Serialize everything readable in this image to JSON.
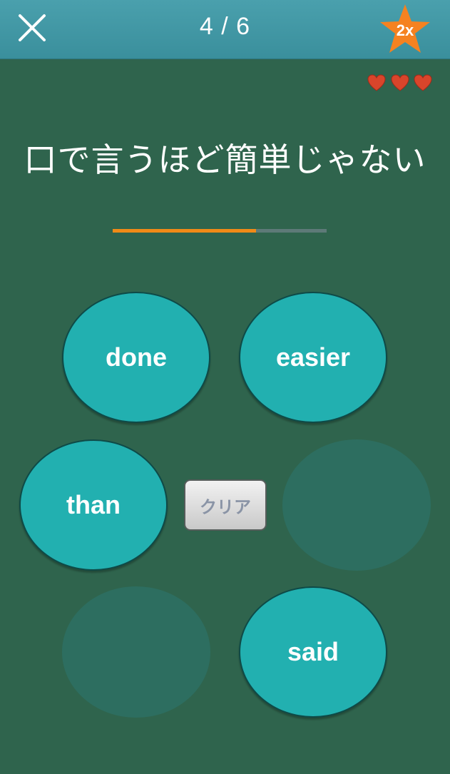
{
  "header": {
    "close_icon": "close-icon",
    "progress_text": "4 / 6",
    "multiplier_label": "2x",
    "multiplier_icon": "star-icon",
    "multiplier_color": "#f58220"
  },
  "lives": {
    "count": 3,
    "icon": "heart-icon",
    "color": "#d9452b"
  },
  "question": {
    "prompt": "口で言うほど簡単じゃない",
    "answer_progress": 0.67
  },
  "word_options": [
    {
      "label": "done"
    },
    {
      "label": "easier"
    },
    {
      "label": "than"
    },
    {
      "label": ""
    },
    {
      "label": ""
    },
    {
      "label": "said"
    }
  ],
  "clear_button": {
    "label": "クリア"
  },
  "colors": {
    "background": "#2f644d",
    "header": "#4aa0ad",
    "bubble": "#22b0b0",
    "bubble_empty": "#2d6e60",
    "progress_fill": "#f08a17",
    "progress_track": "#5e7a78"
  }
}
